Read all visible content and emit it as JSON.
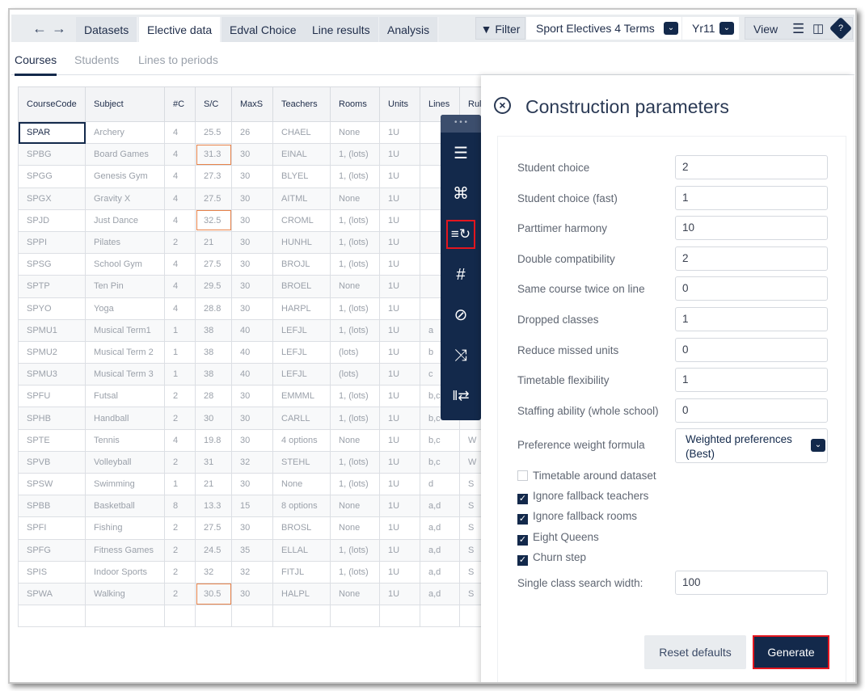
{
  "nav": {
    "tabs": [
      "Datasets",
      "Elective data",
      "Edval Choice",
      "Line results",
      "Analysis"
    ],
    "active_tab": "Elective data",
    "filter_label": "Filter",
    "dataset_select": "Sport Electives 4 Terms",
    "year_select": "Yr11",
    "view_label": "View"
  },
  "subtabs": {
    "items": [
      "Courses",
      "Students",
      "Lines to periods"
    ],
    "active": "Courses"
  },
  "table": {
    "columns": [
      "CourseCode",
      "Subject",
      "#C",
      "S/C",
      "MaxS",
      "Teachers",
      "Rooms",
      "Units",
      "Lines",
      "Rul"
    ],
    "rows": [
      [
        "SPAR",
        "Archery",
        "4",
        "25.5",
        "26",
        "CHAEL",
        "None",
        "1U",
        "",
        ""
      ],
      [
        "SPBG",
        "Board Games",
        "4",
        "31.3",
        "30",
        "EINAL",
        "1, (lots)",
        "1U",
        "",
        ""
      ],
      [
        "SPGG",
        "Genesis Gym",
        "4",
        "27.3",
        "30",
        "BLYEL",
        "1, (lots)",
        "1U",
        "",
        ""
      ],
      [
        "SPGX",
        "Gravity X",
        "4",
        "27.5",
        "30",
        "AITML",
        "None",
        "1U",
        "",
        ""
      ],
      [
        "SPJD",
        "Just Dance",
        "4",
        "32.5",
        "30",
        "CROML",
        "1, (lots)",
        "1U",
        "",
        ""
      ],
      [
        "SPPI",
        "Pilates",
        "2",
        "21",
        "30",
        "HUNHL",
        "1, (lots)",
        "1U",
        "",
        ""
      ],
      [
        "SPSG",
        "School Gym",
        "4",
        "27.5",
        "30",
        "BROJL",
        "1, (lots)",
        "1U",
        "",
        ""
      ],
      [
        "SPTP",
        "Ten Pin",
        "4",
        "29.5",
        "30",
        "BROEL",
        "None",
        "1U",
        "",
        ""
      ],
      [
        "SPYO",
        "Yoga",
        "4",
        "28.8",
        "30",
        "HARPL",
        "1, (lots)",
        "1U",
        "",
        ""
      ],
      [
        "SPMU1",
        "Musical Term1",
        "1",
        "38",
        "40",
        "LEFJL",
        "1, (lots)",
        "1U",
        "a",
        ""
      ],
      [
        "SPMU2",
        "Musical Term 2",
        "1",
        "38",
        "40",
        "LEFJL",
        "(lots)",
        "1U",
        "b",
        ""
      ],
      [
        "SPMU3",
        "Musical Term 3",
        "1",
        "38",
        "40",
        "LEFJL",
        "(lots)",
        "1U",
        "c",
        ""
      ],
      [
        "SPFU",
        "Futsal",
        "2",
        "28",
        "30",
        "EMMML",
        "1, (lots)",
        "1U",
        "b,c",
        ""
      ],
      [
        "SPHB",
        "Handball",
        "2",
        "30",
        "30",
        "CARLL",
        "1, (lots)",
        "1U",
        "b,c",
        ""
      ],
      [
        "SPTE",
        "Tennis",
        "4",
        "19.8",
        "30",
        "4 options",
        "None",
        "1U",
        "b,c",
        "W"
      ],
      [
        "SPVB",
        "Volleyball",
        "2",
        "31",
        "32",
        "STEHL",
        "1, (lots)",
        "1U",
        "b,c",
        "W"
      ],
      [
        "SPSW",
        "Swimming",
        "1",
        "21",
        "30",
        "None",
        "1, (lots)",
        "1U",
        "d",
        "S"
      ],
      [
        "SPBB",
        "Basketball",
        "8",
        "13.3",
        "15",
        "8 options",
        "None",
        "1U",
        "a,d",
        "S"
      ],
      [
        "SPFI",
        "Fishing",
        "2",
        "27.5",
        "30",
        "BROSL",
        "None",
        "1U",
        "a,d",
        "S"
      ],
      [
        "SPFG",
        "Fitness Games",
        "2",
        "24.5",
        "35",
        "ELLAL",
        "1, (lots)",
        "1U",
        "a,d",
        "S"
      ],
      [
        "SPIS",
        "Indoor Sports",
        "2",
        "32",
        "32",
        "FITJL",
        "1, (lots)",
        "1U",
        "a,d",
        "S"
      ],
      [
        "SPWA",
        "Walking",
        "2",
        "30.5",
        "30",
        "HALPL",
        "None",
        "1U",
        "a,d",
        "S"
      ]
    ],
    "highlighted_sc": [
      "SPBG",
      "SPJD",
      "SPWA"
    ],
    "selected_cell": "SPAR"
  },
  "toolbar": {
    "icons": [
      "sliders-icon",
      "command-icon",
      "sort-refresh-icon",
      "hash-icon",
      "ban-icon",
      "shuffle-icon",
      "swap-lines-icon"
    ],
    "highlighted": "sort-refresh-icon"
  },
  "panel": {
    "title": "Construction parameters",
    "fields": [
      {
        "label": "Student choice",
        "value": "2"
      },
      {
        "label": "Student choice (fast)",
        "value": "1"
      },
      {
        "label": "Parttimer harmony",
        "value": "10"
      },
      {
        "label": "Double compatibility",
        "value": "2"
      },
      {
        "label": "Same course twice on line",
        "value": "0"
      },
      {
        "label": "Dropped classes",
        "value": "1"
      },
      {
        "label": "Reduce missed units",
        "value": "0"
      },
      {
        "label": "Timetable flexibility",
        "value": "1"
      },
      {
        "label": "Staffing ability (whole school)",
        "value": "0"
      }
    ],
    "formula": {
      "label": "Preference weight formula",
      "value": "Weighted preferences (Best)"
    },
    "checkboxes": [
      {
        "label": "Timetable around dataset",
        "checked": false
      },
      {
        "label": "Ignore fallback teachers",
        "checked": true
      },
      {
        "label": "Ignore fallback rooms",
        "checked": true
      },
      {
        "label": "Eight Queens",
        "checked": true
      },
      {
        "label": "Churn step",
        "checked": true
      }
    ],
    "search_width": {
      "label": "Single class search width:",
      "value": "100"
    },
    "reset_label": "Reset defaults",
    "generate_label": "Generate"
  },
  "colors": {
    "navy": "#13294b",
    "highlight_red": "#e3161f",
    "cell_highlight": "#e8834a"
  }
}
